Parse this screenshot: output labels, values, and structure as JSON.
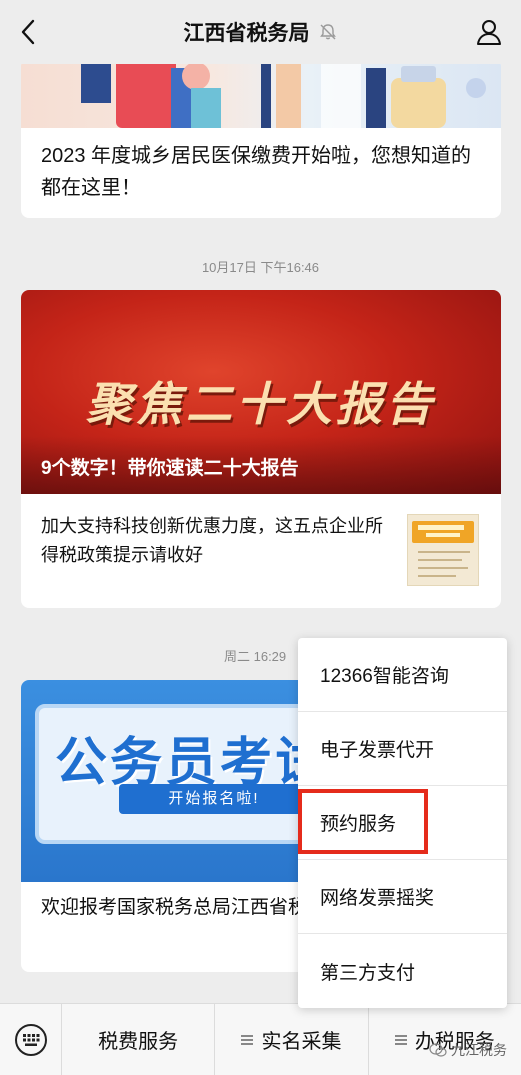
{
  "header": {
    "title": "江西省税务局",
    "back_icon": "chevron-left-icon",
    "mute_icon": "bell-muted-icon",
    "profile_icon": "person-icon"
  },
  "articles": [
    {
      "title": "2023 年度城乡居民医保缴费开始啦，您想知道的都在这里！"
    },
    {
      "timestamp": "10月17日 下午16:46",
      "banner_text": "聚焦二十大报告",
      "banner_caption": "9个数字！带你速读二十大报告",
      "sub_title": "加大支持科技创新优惠力度，这五点企业所得税政策提示请收好",
      "thumb_text": "企业所得税政策"
    },
    {
      "timestamp": "周二 16:29",
      "banner_text": "公务员考试",
      "banner_pill": "开始报名啦!",
      "sub_title": "欢迎报考国家税务总局江西省税务局公务员"
    }
  ],
  "popup_menu": {
    "items": [
      "12366智能咨询",
      "电子发票代开",
      "预约服务",
      "网络发票摇奖",
      "第三方支付"
    ],
    "highlighted": "预约服务",
    "highlight_color": "#e52b1b"
  },
  "bottom_menu": {
    "keyboard_icon": "keyboard-icon",
    "tabs": [
      "税费服务",
      "实名采集",
      "办税服务"
    ]
  },
  "watermark": "九江税务"
}
